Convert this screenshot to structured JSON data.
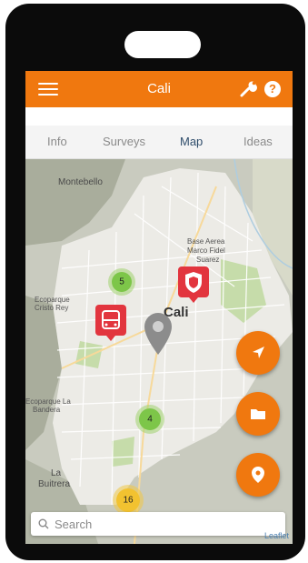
{
  "app": {
    "title": "Cali",
    "menu_icon": "hamburger-icon",
    "settings_icon": "wrench-icon",
    "help_label": "?"
  },
  "tabs": [
    {
      "label": "Info",
      "active": false
    },
    {
      "label": "Surveys",
      "active": false
    },
    {
      "label": "Map",
      "active": true
    },
    {
      "label": "Ideas",
      "active": false
    }
  ],
  "map": {
    "labels": {
      "montebello": "Montebello",
      "cali": "Cali",
      "base_aerea": "Base Aerea",
      "marco_fidel": "Marco Fidel",
      "suarez": "Suarez",
      "ecoparque_cristo1": "Ecoparque",
      "ecoparque_cristo2": "Cristo Rey",
      "ecoparque_bandera1": "Ecoparque La",
      "ecoparque_bandera2": "Bandera",
      "buitrera1": "La",
      "buitrera2": "Buitrera"
    },
    "clusters": [
      {
        "count": "5",
        "color": "green"
      },
      {
        "count": "4",
        "color": "green"
      },
      {
        "count": "16",
        "color": "yellow"
      }
    ],
    "markers": [
      {
        "type": "bus-icon"
      },
      {
        "type": "shield-icon"
      }
    ],
    "attribution": "Leaflet"
  },
  "search": {
    "placeholder": "Search"
  },
  "colors": {
    "accent": "#f0780f",
    "tab_active": "#2f4d6b",
    "marker": "#e2353e",
    "cluster_green": "#7dc649",
    "cluster_yellow": "#f2c230"
  }
}
